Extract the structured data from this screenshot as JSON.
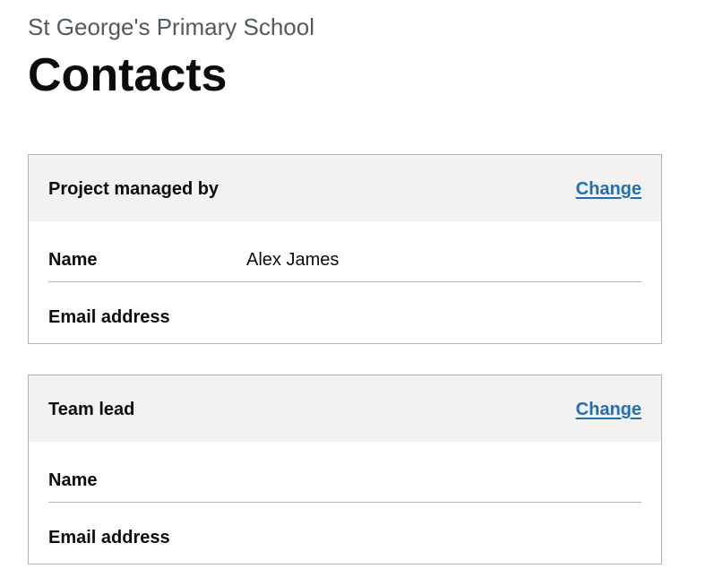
{
  "header": {
    "caption": "St George's Primary School",
    "title": "Contacts"
  },
  "cards": [
    {
      "title": "Project managed by",
      "action_label": "Change",
      "rows": [
        {
          "key": "Name",
          "value": "Alex James"
        },
        {
          "key": "Email address",
          "value": ""
        }
      ]
    },
    {
      "title": "Team lead",
      "action_label": "Change",
      "rows": [
        {
          "key": "Name",
          "value": ""
        },
        {
          "key": "Email address",
          "value": ""
        }
      ]
    }
  ],
  "colors": {
    "link": "#1d70b8",
    "header_background": "#f3f2f1",
    "border": "#b1b4b6",
    "text": "#0b0c0c",
    "caption_text": "#505a5f"
  }
}
